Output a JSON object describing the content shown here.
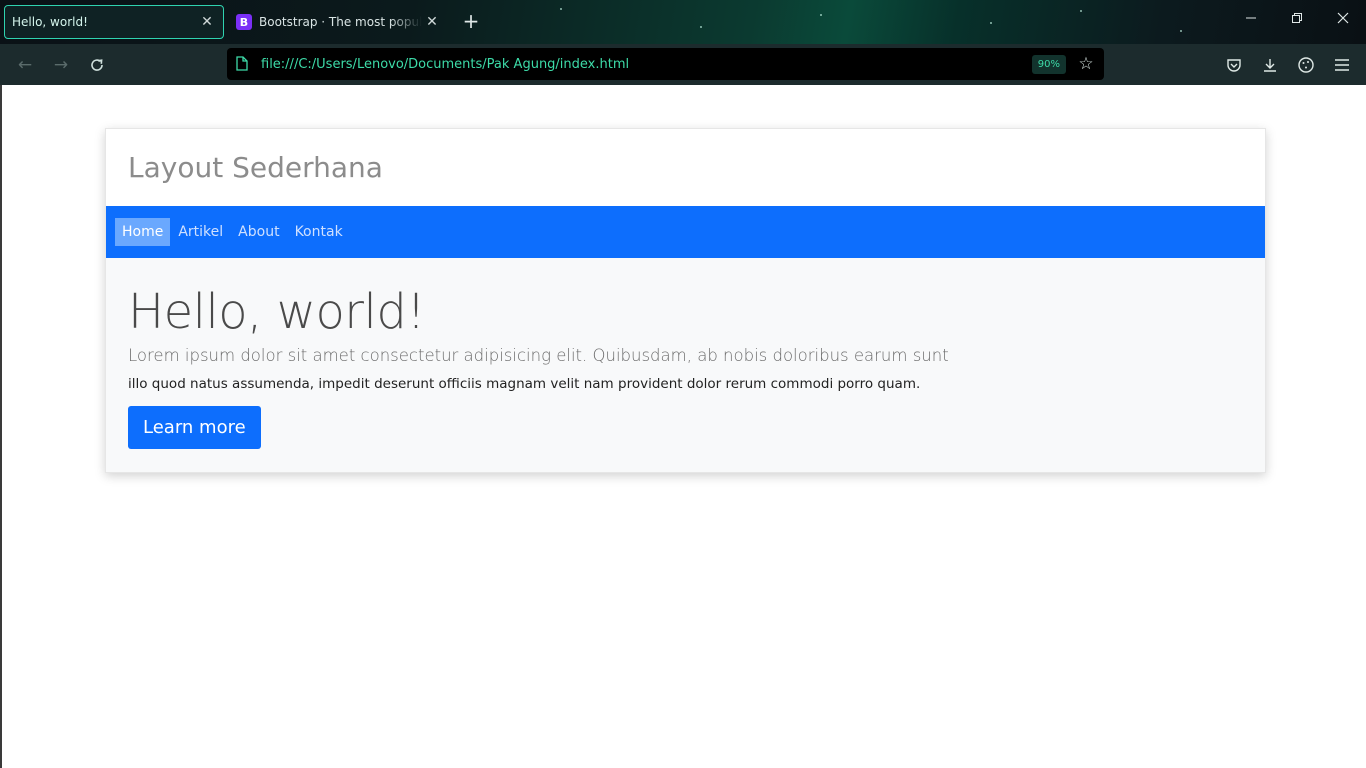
{
  "browser": {
    "tabs": [
      {
        "title": "Hello, world!",
        "active": true
      },
      {
        "title": "Bootstrap · The most popular HTML",
        "active": false,
        "favicon_letter": "B"
      }
    ],
    "url": "file:///C:/Users/Lenovo/Documents/Pak Agung/index.html",
    "zoom": "90%",
    "accent_color": "#3ddba8"
  },
  "page": {
    "site_title": "Layout Sederhana",
    "nav": [
      {
        "label": "Home",
        "active": true
      },
      {
        "label": "Artikel",
        "active": false
      },
      {
        "label": "About",
        "active": false
      },
      {
        "label": "Kontak",
        "active": false
      }
    ],
    "jumbotron": {
      "title": "Hello, world!",
      "lead": "Lorem ipsum dolor sit amet consectetur adipisicing elit. Quibusdam, ab nobis doloribus earum sunt",
      "body": "illo quod natus assumenda, impedit deserunt officiis magnam velit nam provident dolor rerum commodi porro quam.",
      "button_label": "Learn more"
    },
    "colors": {
      "primary": "#0d6efd",
      "nav_active_bg": "#6aa8fe",
      "jumbotron_bg": "#f8f9fa"
    }
  }
}
